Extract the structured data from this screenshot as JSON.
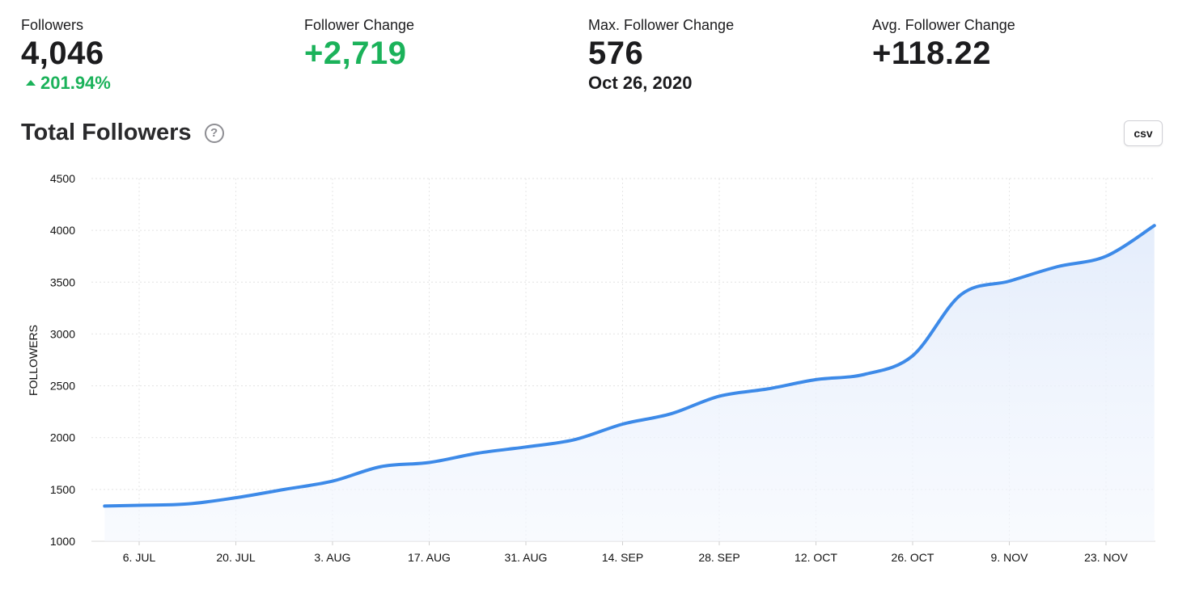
{
  "stats": {
    "followers": {
      "label": "Followers",
      "value": "4,046",
      "change": "201.94%"
    },
    "follower_change": {
      "label": "Follower Change",
      "value": "+2,719"
    },
    "max_change": {
      "label": "Max. Follower Change",
      "value": "576",
      "date": "Oct 26, 2020"
    },
    "avg_change": {
      "label": "Avg. Follower Change",
      "value": "+118.22"
    }
  },
  "chart_header": {
    "title": "Total Followers",
    "help_icon": "?",
    "csv_label": "csv"
  },
  "colors": {
    "line": "#3d8ae8",
    "fill": "#eef4fd",
    "positive": "#1bb25a",
    "grid": "#dcdcdc"
  },
  "chart_data": {
    "type": "area",
    "title": "Total Followers",
    "xlabel": "",
    "ylabel": "FOLLOWERS",
    "ylim": [
      1000,
      4500
    ],
    "yticks": [
      1000,
      1500,
      2000,
      2500,
      3000,
      3500,
      4000,
      4500
    ],
    "xticks": [
      "6. JUL",
      "20. JUL",
      "3. AUG",
      "17. AUG",
      "31. AUG",
      "14. SEP",
      "28. SEP",
      "12. OCT",
      "26. OCT",
      "9. NOV",
      "23. NOV"
    ],
    "grid": true,
    "series": [
      {
        "x": [
          "2020-07-01",
          "2020-07-06",
          "2020-07-13",
          "2020-07-20",
          "2020-07-27",
          "2020-08-03",
          "2020-08-10",
          "2020-08-17",
          "2020-08-24",
          "2020-08-31",
          "2020-09-07",
          "2020-09-14",
          "2020-09-21",
          "2020-09-28",
          "2020-10-05",
          "2020-10-12",
          "2020-10-19",
          "2020-10-26",
          "2020-11-02",
          "2020-11-09",
          "2020-11-16",
          "2020-11-23",
          "2020-11-30"
        ],
        "y": [
          1340,
          1347,
          1360,
          1420,
          1500,
          1580,
          1720,
          1760,
          1850,
          1910,
          1980,
          2130,
          2230,
          2400,
          2470,
          2560,
          2610,
          2790,
          3380,
          3510,
          3650,
          3750,
          4046
        ]
      }
    ]
  }
}
